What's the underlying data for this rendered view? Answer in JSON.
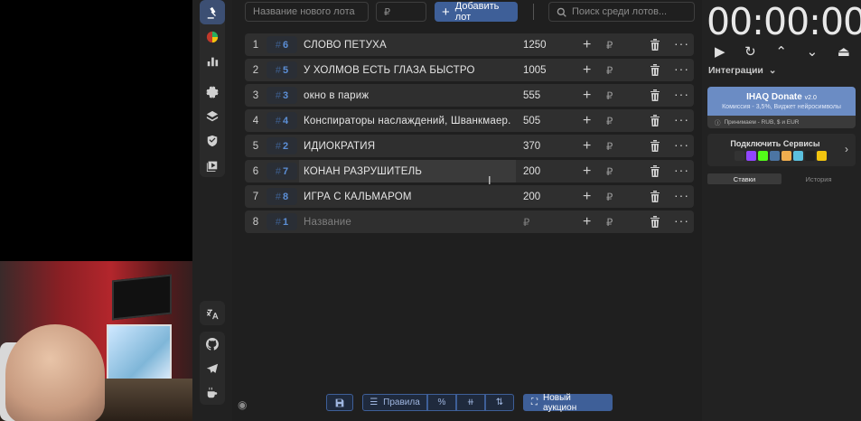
{
  "topbar": {
    "name_placeholder": "Название нового лота",
    "amount_placeholder": "₽",
    "add_label": "Добавить лот",
    "search_placeholder": "Поиск среди лотов..."
  },
  "lots": [
    {
      "index": "1",
      "id": "6",
      "name": "СЛОВО ПЕТУХА",
      "amount": "1250"
    },
    {
      "index": "2",
      "id": "5",
      "name": "У ХОЛМОВ ЕСТЬ ГЛАЗА БЫСТРО",
      "amount": "1005"
    },
    {
      "index": "3",
      "id": "3",
      "name": "окно в париж",
      "amount": "555"
    },
    {
      "index": "4",
      "id": "4",
      "name": "Конспираторы наслаждений, Шванкмаер.",
      "amount": "505"
    },
    {
      "index": "5",
      "id": "2",
      "name": "ИДИОКРАТИЯ",
      "amount": "370"
    },
    {
      "index": "6",
      "id": "7",
      "name": "КОНАН РАЗРУШИТЕЛЬ",
      "amount": "200"
    },
    {
      "index": "7",
      "id": "8",
      "name": "ИГРА С КАЛЬМАРОМ",
      "amount": "200"
    },
    {
      "index": "8",
      "id": "1",
      "name": "Название",
      "amount": "₽"
    }
  ],
  "currency": "₽",
  "bottombar": {
    "rules_label": "Правила",
    "percent_label": "%",
    "new_auction_label": "Новый аукцион"
  },
  "right": {
    "timer": "00:00:00",
    "integrations_label": "Интеграции",
    "donate_title": "IHAQ Donate",
    "donate_version": "v2.0",
    "donate_commission": "Комиссия - 3,5%, Виджет нейросимволы",
    "donate_accepts": "Принимаем - RUB, $ и EUR",
    "services_label": "Подключить Сервисы",
    "tab_bids": "Ставки",
    "tab_history": "История"
  },
  "colors": {
    "accent": "#3e5f98",
    "background": "#1f1f1f",
    "row": "#2f2f2f",
    "tag_text": "#5c8fd6"
  }
}
